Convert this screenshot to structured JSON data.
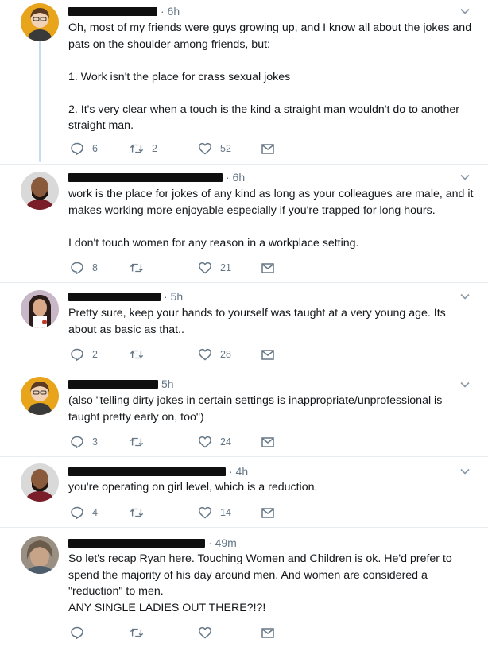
{
  "colors": {
    "icon": "#657786",
    "thread_line": "#c4dbf0",
    "text": "#14171a",
    "redaction": "#0f0f0f"
  },
  "icons": {
    "reply": "reply-icon",
    "retweet": "retweet-icon",
    "like": "heart-icon",
    "dm": "envelope-icon",
    "menu": "chevron-down-icon"
  },
  "tweets": [
    {
      "time": "· 6h",
      "paragraphs": [
        "Oh, most of my friends were guys growing up, and I know all about the jokes and pats on the shoulder among friends, but:",
        "1. Work isn't the place for crass sexual jokes",
        "2. It's very clear when a touch is the kind a straight man wouldn't do to another straight man."
      ],
      "replies": "6",
      "retweets": "2",
      "likes": "52"
    },
    {
      "time": "· 6h",
      "paragraphs": [
        "work is the place for jokes of any kind as long as your colleagues are male, and it makes working more enjoyable especially if you're trapped for long hours.",
        "I don't touch women for any reason in a workplace setting."
      ],
      "replies": "8",
      "retweets": "",
      "likes": "21"
    },
    {
      "time": "· 5h",
      "paragraphs": [
        "Pretty sure, keep your hands to yourself was taught at a very young age. Its about as basic as that.."
      ],
      "replies": "2",
      "retweets": "",
      "likes": "28"
    },
    {
      "time": "5h",
      "paragraphs": [
        "(also \"telling dirty jokes in certain settings is inappropriate/unprofessional is taught pretty early on, too\")"
      ],
      "replies": "3",
      "retweets": "",
      "likes": "24"
    },
    {
      "time": "· 4h",
      "paragraphs": [
        "you're operating on girl level, which is a reduction."
      ],
      "replies": "4",
      "retweets": "",
      "likes": "14"
    },
    {
      "time": "· 49m",
      "paragraphs": [
        "So let's recap Ryan here. Touching Women and Children is ok. He'd prefer to spend the majority of his day around men. And women are considered a \"reduction\" to men.\nANY SINGLE LADIES OUT THERE?!?!"
      ],
      "replies": "",
      "retweets": "",
      "likes": ""
    }
  ]
}
